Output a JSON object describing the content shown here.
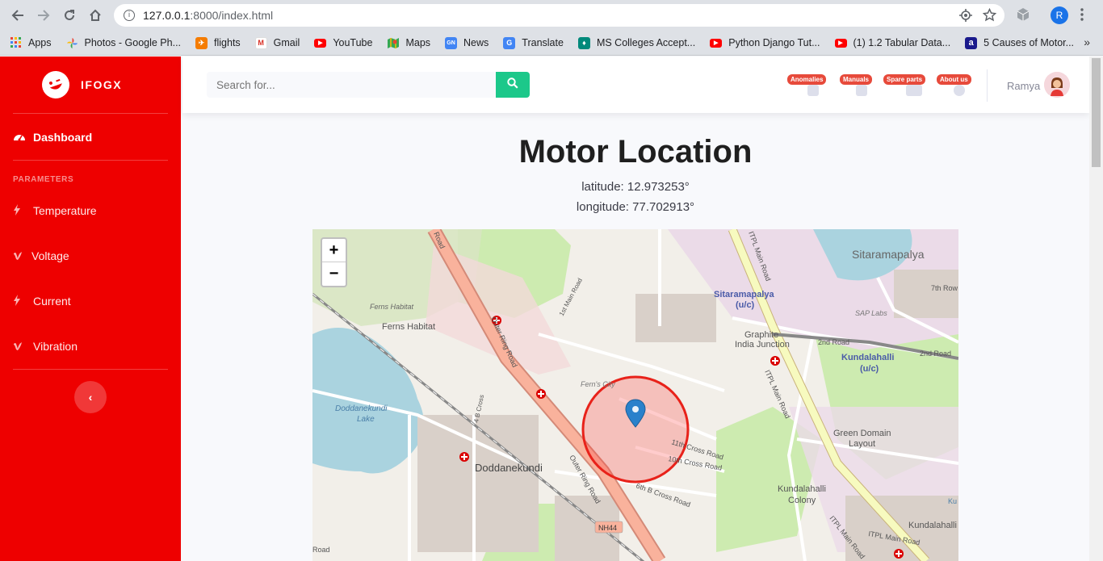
{
  "browser": {
    "url_host": "127.0.0.1",
    "url_path": ":8000/index.html",
    "profile_initial": "R",
    "bookmarks": [
      {
        "label": "Apps",
        "color": "#4285f4",
        "icon": "apps-grid-icon"
      },
      {
        "label": "Photos - Google Ph...",
        "color": "#fbbc05",
        "icon": "google-photos-icon"
      },
      {
        "label": "flights",
        "color": "#f57c00",
        "icon": "flights-icon"
      },
      {
        "label": "Gmail",
        "color": "#d93025",
        "icon": "gmail-icon"
      },
      {
        "label": "YouTube",
        "color": "#ff0000",
        "icon": "youtube-icon"
      },
      {
        "label": "Maps",
        "color": "#34a853",
        "icon": "maps-icon"
      },
      {
        "label": "News",
        "color": "#4285f4",
        "icon": "news-icon"
      },
      {
        "label": "Translate",
        "color": "#4285f4",
        "icon": "translate-icon"
      },
      {
        "label": "MS Colleges Accept...",
        "color": "#00897b",
        "icon": "bookmark-icon"
      },
      {
        "label": "Python Django Tut...",
        "color": "#ff0000",
        "icon": "youtube-icon"
      },
      {
        "label": "(1) 1.2 Tabular Data...",
        "color": "#ff0000",
        "icon": "youtube-icon"
      },
      {
        "label": "5 Causes of Motor...",
        "color": "#1a1a8c",
        "icon": "bookmark-icon"
      }
    ]
  },
  "sidebar": {
    "brand": "IFOGX",
    "dashboard": "Dashboard",
    "heading": "PARAMETERS",
    "items": [
      {
        "label": "Temperature",
        "icon": "bolt-icon"
      },
      {
        "label": "Voltage",
        "icon": "vimeo-v-icon"
      },
      {
        "label": "Current",
        "icon": "bolt-icon"
      },
      {
        "label": "Vibration",
        "icon": "vimeo-v-icon"
      }
    ]
  },
  "topbar": {
    "search_placeholder": "Search for...",
    "badges": [
      "Anomalies",
      "Manuals",
      "Spare parts",
      "About us"
    ],
    "user": "Ramya"
  },
  "main": {
    "title": "Motor Location",
    "latitude": "latitude: 12.973253°",
    "longitude": "longitude: 77.702913°"
  },
  "map": {
    "zoom_in": "+",
    "zoom_out": "−",
    "labels": {
      "sitaramapalya": "Sitaramapalya",
      "sitaramapalya_uc_1": "Sitaramapalya",
      "sitaramapalya_uc_2": "(u/c)",
      "seventh_row": "7th Row",
      "sap": "SAP Labs",
      "graphite_1": "Graphite",
      "graphite_2": "India Junction",
      "second_road_1": "2nd Road",
      "second_road_2": "2nd Road",
      "kundalahalli_uc_1": "Kundalahalli",
      "kundalahalli_uc_2": "(u/c)",
      "ferns_1": "Ferns Habitat",
      "ferns_2": "Ferns Habitat",
      "first_main": "1st Main Road",
      "outer_ring_1": "Outer Ring Road",
      "outer_ring_2": "Outer Ring Road",
      "outer_ring_3": "Outer Ring Road",
      "ring_road_top": "Road",
      "lake_1": "Doddanekundi",
      "lake_2": "Lake",
      "doddanekundi": "Doddanekundi",
      "fern_city": "Fern's City",
      "cross_11": "11th Cross Road",
      "cross_10": "10th Cross Road",
      "cross_6": "6th B Cross Road",
      "cross_4": "4 B Cross",
      "green_domain_1": "Green Domain",
      "green_domain_2": "Layout",
      "kundalahalli_colony_1": "Kundalahalli",
      "kundalahalli_colony_2": "Colony",
      "kundalahalli_br": "Kundalahalli",
      "itpl_1": "ITPL Main Road",
      "itpl_2": "ITPL Main Road",
      "itpl_3": "ITPL Main Road",
      "itpl_top": "ITPL Main Road",
      "nh44": "NH44",
      "k_right": "Ku",
      "road_bottom": "Road"
    }
  }
}
